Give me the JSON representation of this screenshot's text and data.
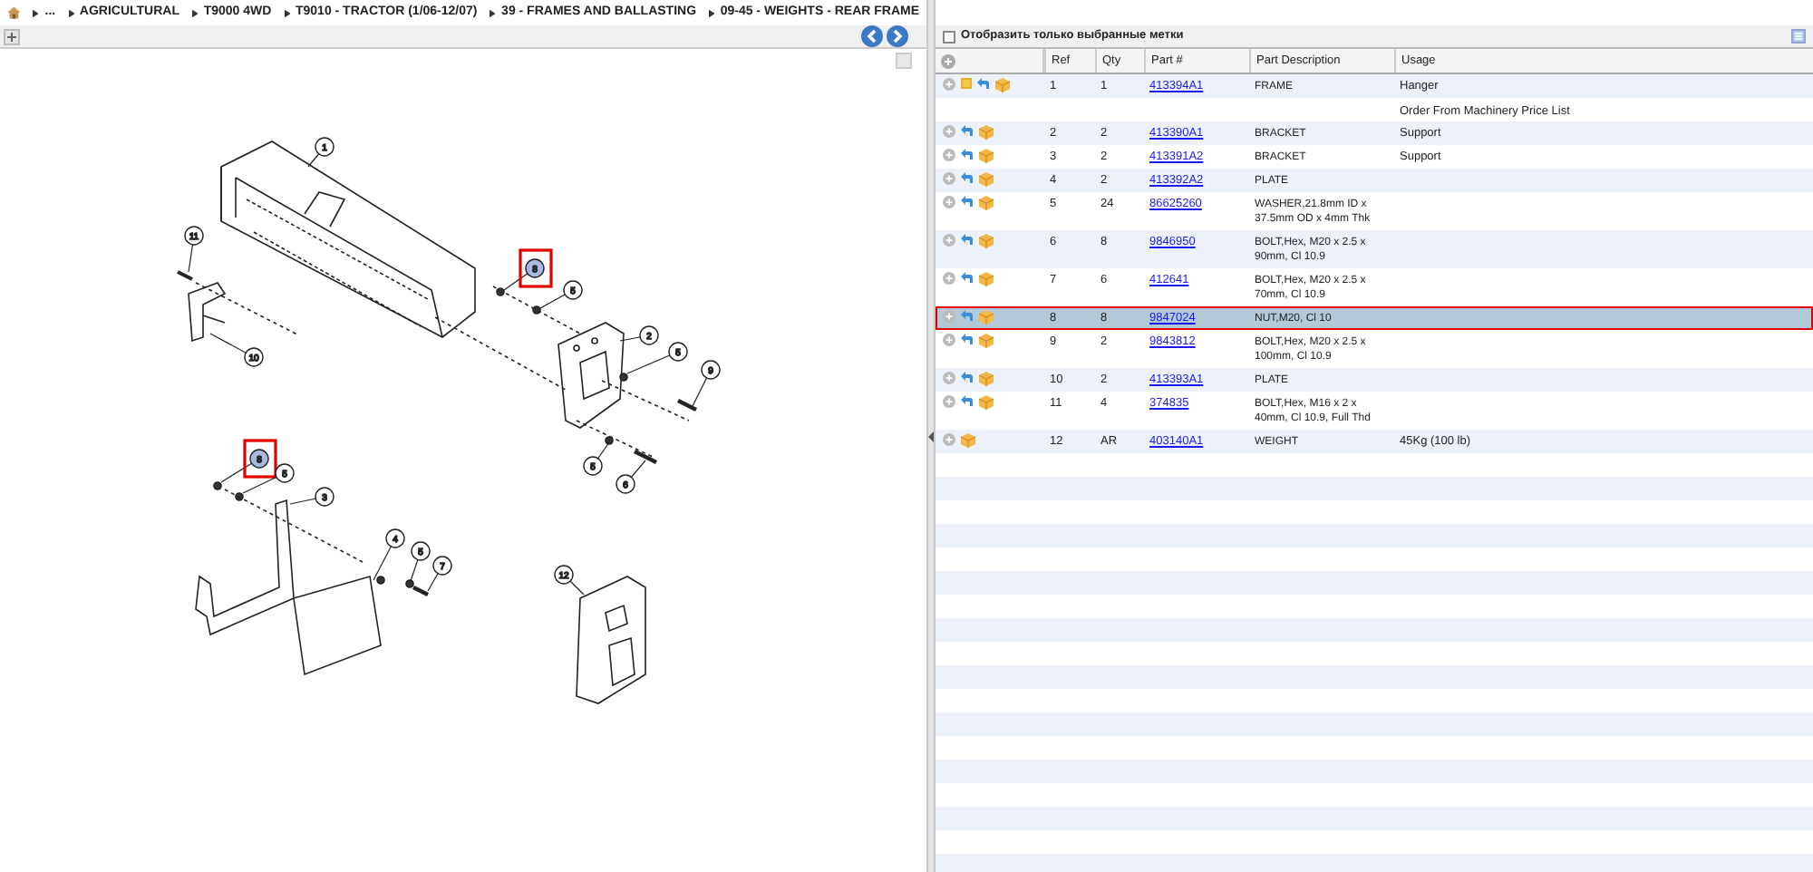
{
  "breadcrumb": [
    "...",
    "AGRICULTURAL",
    "T9000 4WD",
    "T9010 - TRACTOR (1/06-12/07)",
    "39 - FRAMES AND BALLASTING",
    "09-45 - WEIGHTS - REAR FRAME"
  ],
  "diagram": {
    "callouts": [
      {
        "label": "1",
        "selected": false
      },
      {
        "label": "11",
        "selected": false
      },
      {
        "label": "10",
        "selected": false
      },
      {
        "label": "8",
        "selected": true
      },
      {
        "label": "5",
        "selected": false
      },
      {
        "label": "2",
        "selected": false
      },
      {
        "label": "5",
        "selected": false
      },
      {
        "label": "9",
        "selected": false
      },
      {
        "label": "5",
        "selected": false
      },
      {
        "label": "6",
        "selected": false
      },
      {
        "label": "8",
        "selected": true
      },
      {
        "label": "5",
        "selected": false
      },
      {
        "label": "3",
        "selected": false
      },
      {
        "label": "4",
        "selected": false
      },
      {
        "label": "5",
        "selected": false
      },
      {
        "label": "7",
        "selected": false
      },
      {
        "label": "12",
        "selected": false
      }
    ]
  },
  "filter": {
    "label": "Отобразить только выбранные метки",
    "checked": false
  },
  "table": {
    "columns": [
      "Ref",
      "Qty",
      "Part #",
      "Part Description",
      "Usage"
    ],
    "rows": [
      {
        "kind": "part",
        "has_note": true,
        "has_arrow": true,
        "ref": "1",
        "qty": "1",
        "part_number": "413394A1",
        "description": "FRAME",
        "usage": "Hanger",
        "selected": false
      },
      {
        "kind": "note",
        "usage": "Order From Machinery Price List"
      },
      {
        "kind": "part",
        "has_note": false,
        "has_arrow": true,
        "ref": "2",
        "qty": "2",
        "part_number": "413390A1",
        "description": "BRACKET",
        "usage": "Support",
        "selected": false
      },
      {
        "kind": "part",
        "has_note": false,
        "has_arrow": true,
        "ref": "3",
        "qty": "2",
        "part_number": "413391A2",
        "description": "BRACKET",
        "usage": "Support",
        "selected": false
      },
      {
        "kind": "part",
        "has_note": false,
        "has_arrow": true,
        "ref": "4",
        "qty": "2",
        "part_number": "413392A2",
        "description": "PLATE",
        "selected": false
      },
      {
        "kind": "part",
        "has_note": false,
        "has_arrow": true,
        "ref": "5",
        "qty": "24",
        "part_number": "86625260",
        "description": "WASHER,21.8mm ID x 37.5mm OD x 4mm Thk",
        "selected": false
      },
      {
        "kind": "part",
        "has_note": false,
        "has_arrow": true,
        "ref": "6",
        "qty": "8",
        "part_number": "9846950",
        "description": "BOLT,Hex, M20 x 2.5 x 90mm, Cl 10.9",
        "selected": false
      },
      {
        "kind": "part",
        "has_note": false,
        "has_arrow": true,
        "ref": "7",
        "qty": "6",
        "part_number": "412641",
        "description": "BOLT,Hex, M20 x 2.5 x 70mm, Cl 10.9",
        "selected": false
      },
      {
        "kind": "part",
        "has_note": false,
        "has_arrow": true,
        "ref": "8",
        "qty": "8",
        "part_number": "9847024",
        "description": "NUT,M20, Cl 10",
        "selected": true
      },
      {
        "kind": "part",
        "has_note": false,
        "has_arrow": true,
        "ref": "9",
        "qty": "2",
        "part_number": "9843812",
        "description": "BOLT,Hex, M20 x 2.5 x 100mm, Cl 10.9",
        "selected": false
      },
      {
        "kind": "part",
        "has_note": false,
        "has_arrow": true,
        "ref": "10",
        "qty": "2",
        "part_number": "413393A1",
        "description": "PLATE",
        "selected": false
      },
      {
        "kind": "part",
        "has_note": false,
        "has_arrow": true,
        "ref": "11",
        "qty": "4",
        "part_number": "374835",
        "description": "BOLT,Hex, M16 x 2 x 40mm, Cl 10.9, Full Thd",
        "selected": false
      },
      {
        "kind": "part",
        "has_note": false,
        "has_arrow": false,
        "ref": "12",
        "qty": "AR",
        "part_number": "403140A1",
        "description": "WEIGHT",
        "usage": "45Kg (100 lb)",
        "selected": false
      }
    ]
  }
}
